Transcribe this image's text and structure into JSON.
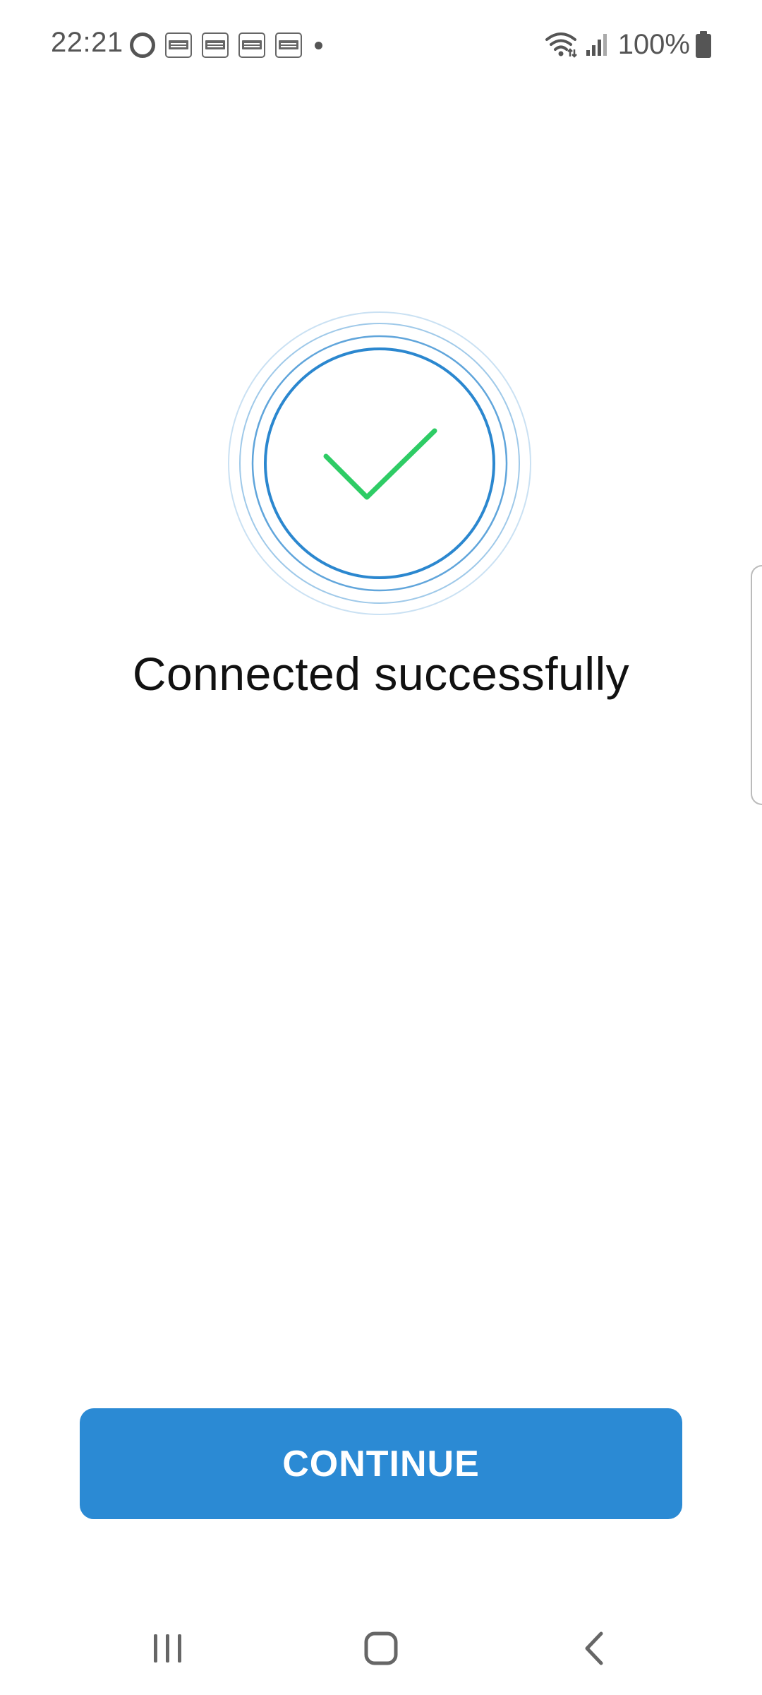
{
  "status_bar": {
    "time": "22:21",
    "battery": "100%",
    "icons": [
      "circle-icon",
      "news-app-icon",
      "news-app-icon",
      "news-app-icon",
      "news-app-icon",
      "dot-icon",
      "wifi-icon",
      "signal-icon",
      "battery-icon"
    ]
  },
  "main": {
    "title": "Connected successfully",
    "icon": "checkmark-icon"
  },
  "continue_button": {
    "label": "CONTINUE"
  },
  "nav_bar": {
    "icons": [
      "recents-icon",
      "home-icon",
      "back-icon"
    ]
  },
  "colors": {
    "accent": "#2b8ad4",
    "ring": "#2b87cf",
    "check": "#2ecc65",
    "text": "#111111",
    "status_text": "#555555"
  }
}
